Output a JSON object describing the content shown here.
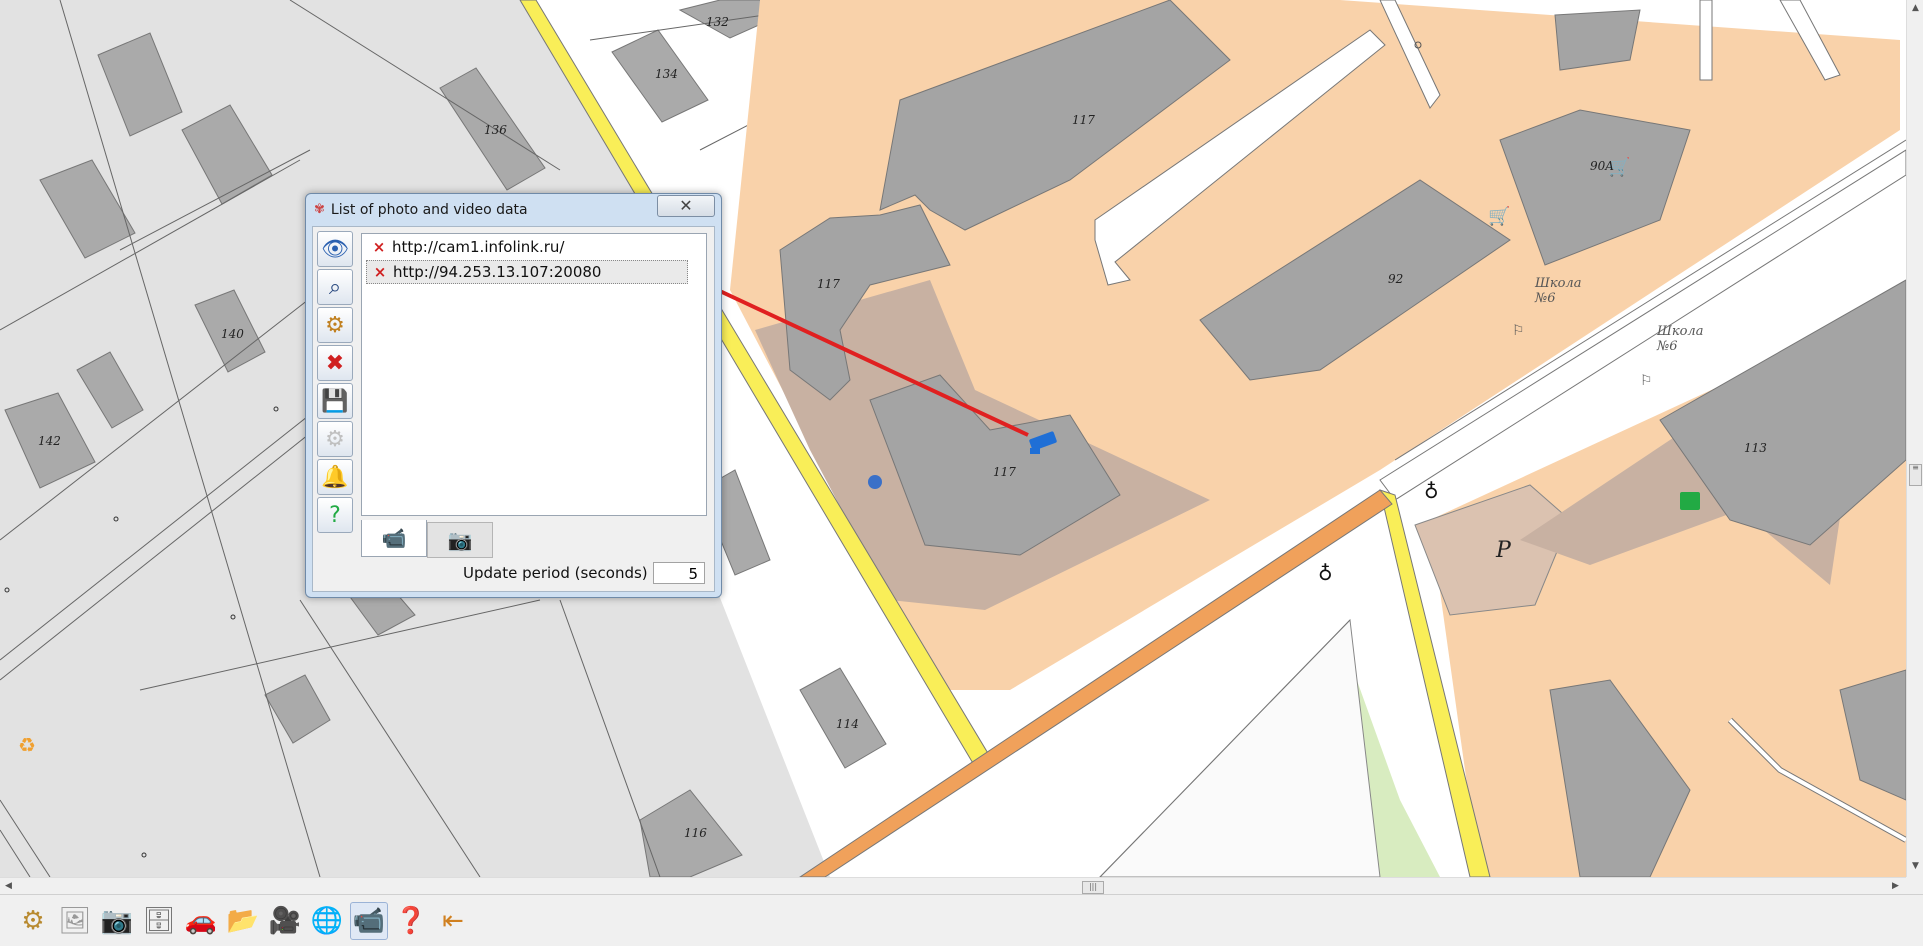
{
  "dialog": {
    "title": "List of photo and video data",
    "close_glyph": "✕",
    "urls": [
      {
        "remove_icon": "×",
        "url": "http://cam1.infolink.ru/"
      },
      {
        "remove_icon": "×",
        "url": "http://94.253.13.107:20080"
      }
    ],
    "selected_index": 1,
    "side_buttons": [
      "view-icon",
      "binoculars-icon",
      "camera-settings-icon",
      "delete-icon",
      "save-icon",
      "settings-disabled-icon",
      "alarm-bell-icon",
      "help-icon"
    ],
    "tabs": [
      "video-camera-tab",
      "photo-camera-tab"
    ],
    "period_label": "Update period (seconds)",
    "period_value": "5"
  },
  "map": {
    "house_numbers": [
      "132",
      "134",
      "136",
      "140",
      "142",
      "114",
      "116",
      "117",
      "117",
      "117",
      "92",
      "90A",
      "113"
    ],
    "school_label_1": "Школа",
    "school_num_1": "№6",
    "school_label_2": "Школа",
    "school_num_2": "№6",
    "parking_label": "P"
  },
  "toolbar": {
    "buttons": [
      "settings-gear-icon",
      "photo-folder-icon",
      "cameras-icon",
      "database-icon",
      "road-car-icon",
      "folder-refresh-icon",
      "camera-list-icon",
      "globe-camera-icon",
      "video-camera-active-icon",
      "help-icon",
      "exit-icon"
    ],
    "active_button": "video-camera-active-icon"
  },
  "colors": {
    "zone": "#f8d0a7",
    "building": "#a4a4a4",
    "yard": "#c7b1a2",
    "road_yellow": "#f9ee58",
    "road_orange": "#f0a15b",
    "arrow_red": "#e02020"
  }
}
